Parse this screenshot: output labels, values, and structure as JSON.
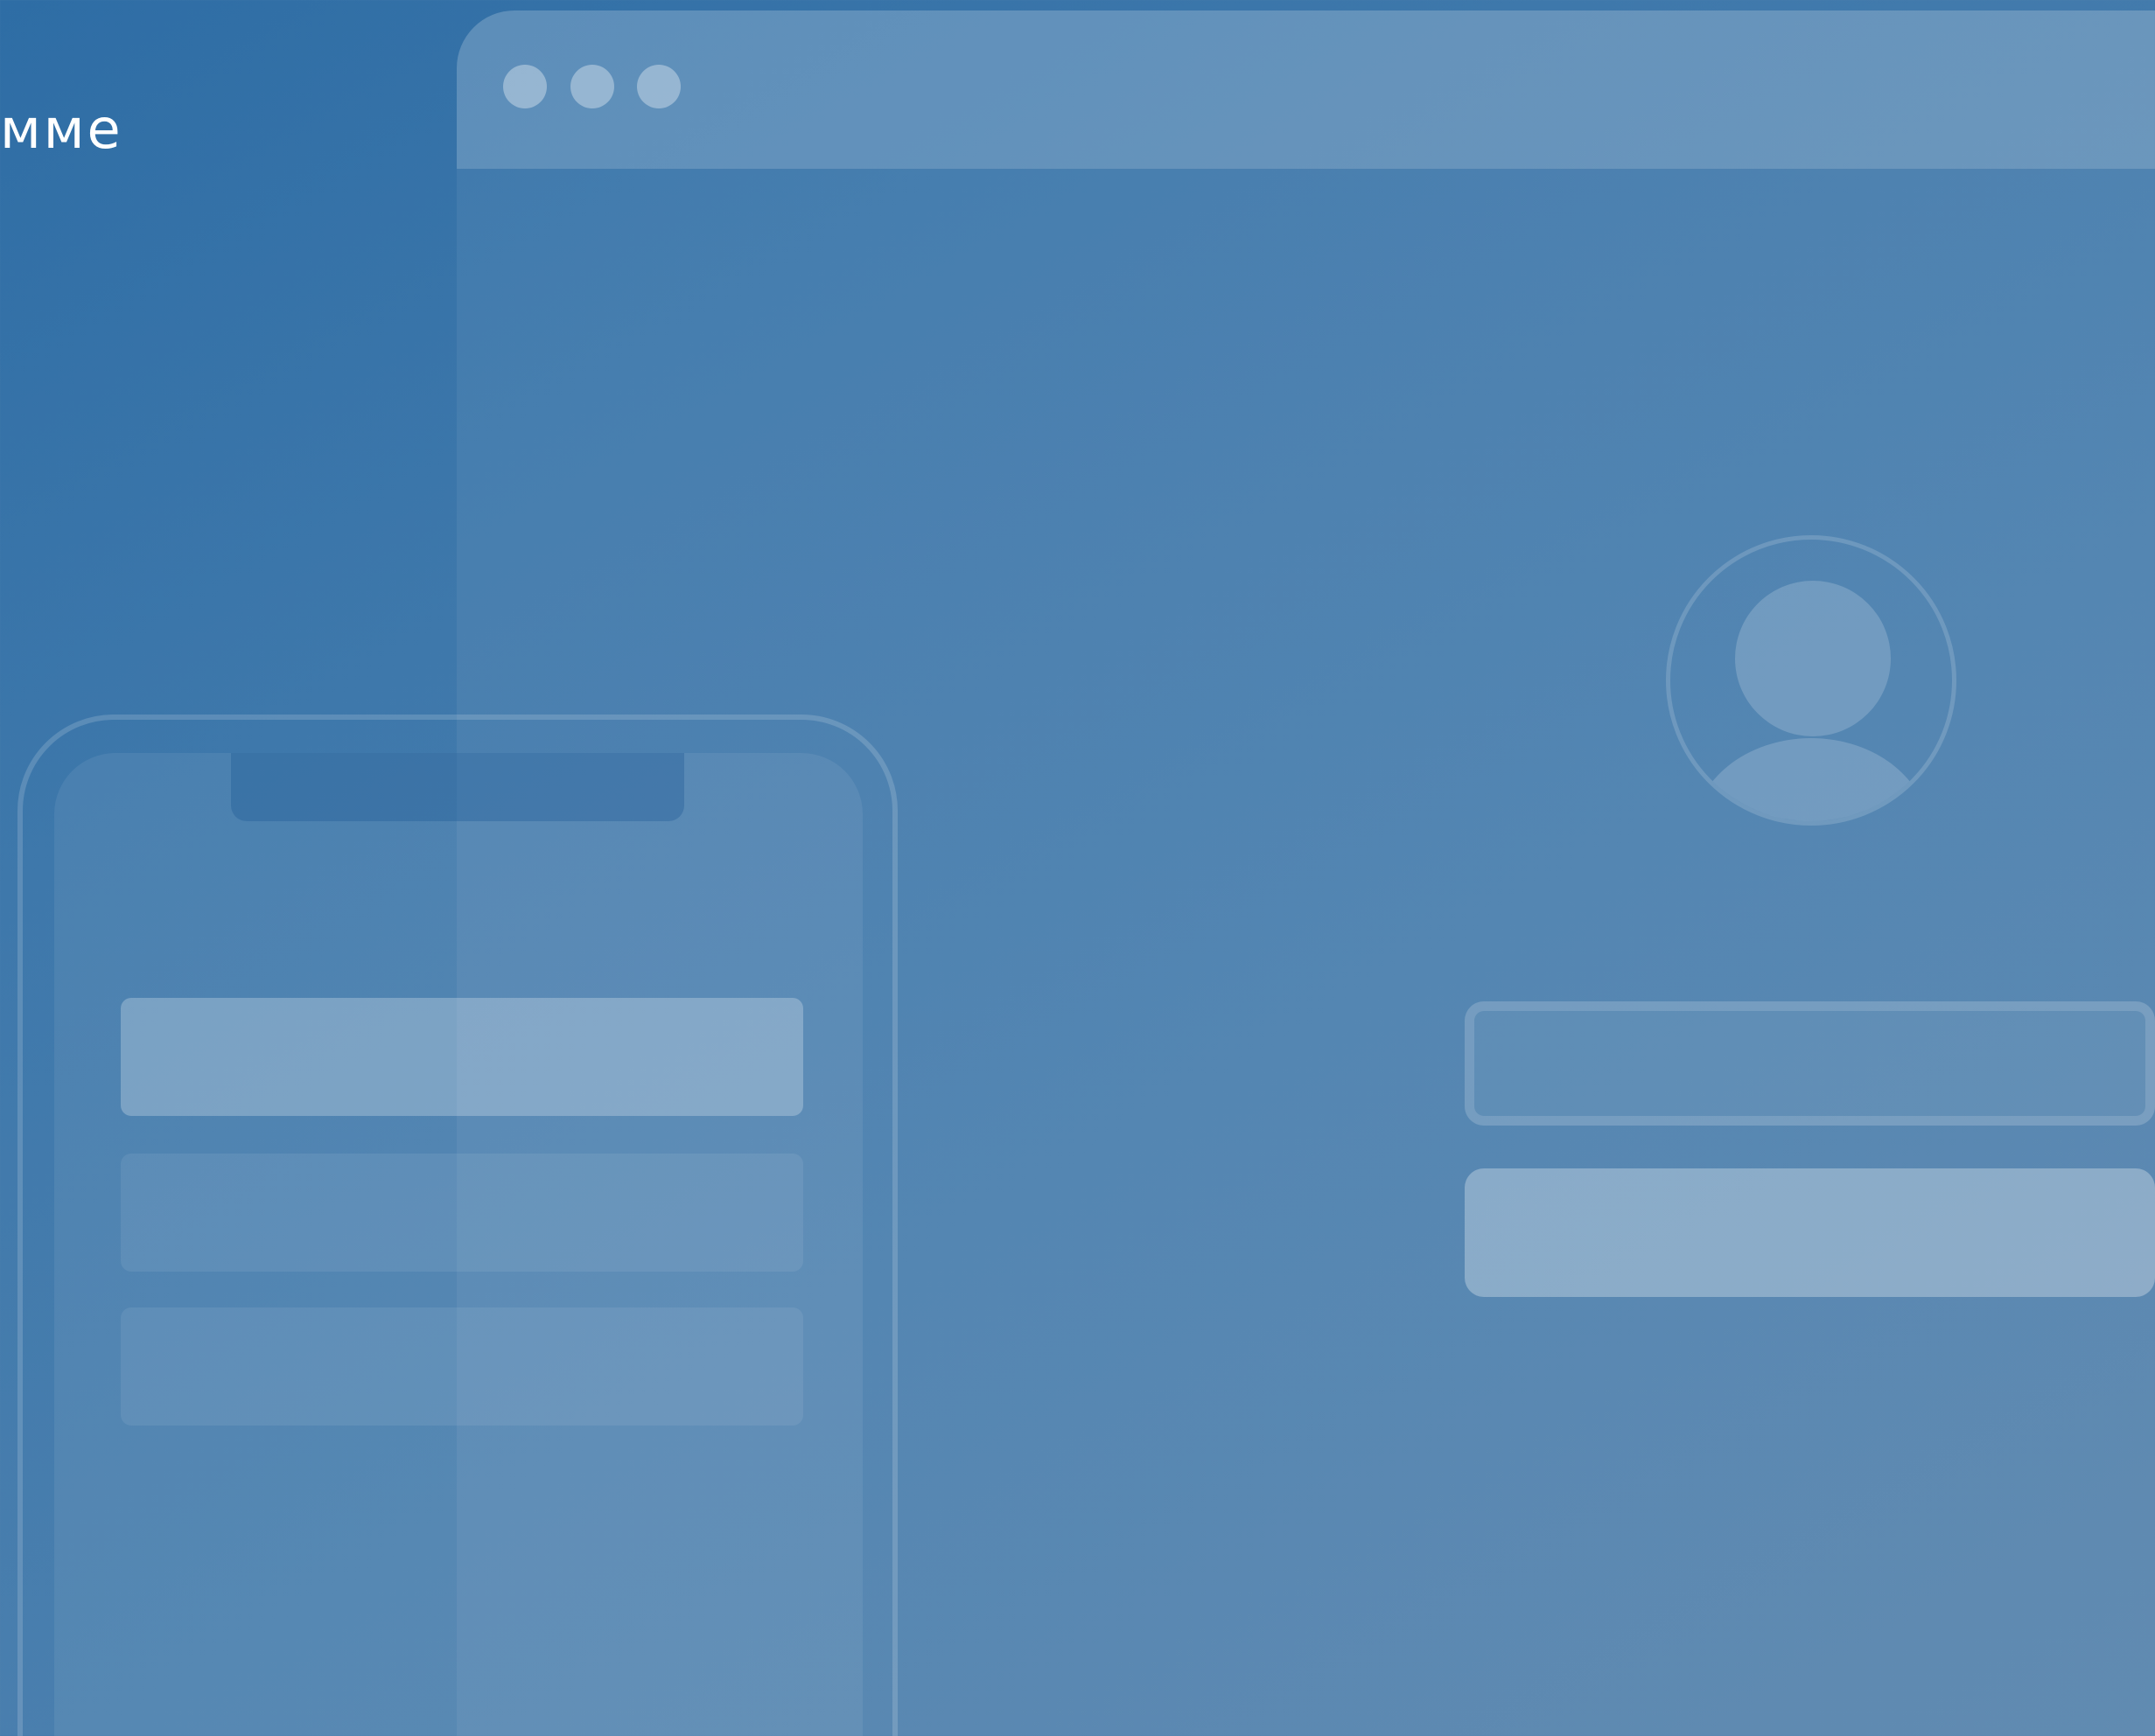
{
  "brand": {
    "text": "мме"
  },
  "browser": {
    "window_controls": [
      "window-dot",
      "window-dot",
      "window-dot"
    ]
  },
  "login_form": {
    "avatar_icon": "user-avatar-icon",
    "username_value": "",
    "submit_label": ""
  },
  "phone": {
    "rows": [
      "",
      "",
      ""
    ]
  }
}
